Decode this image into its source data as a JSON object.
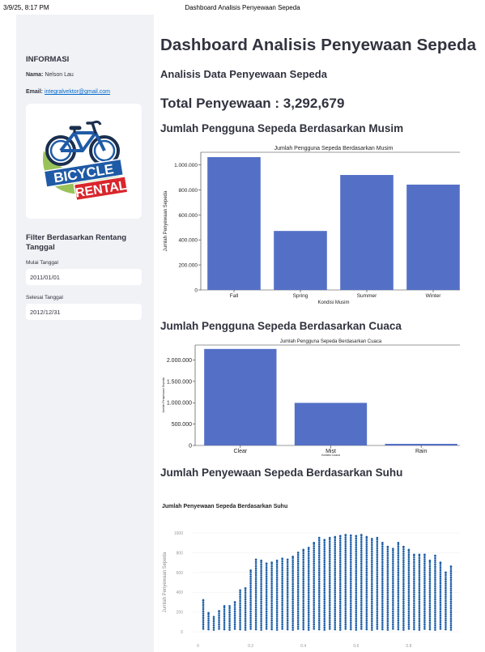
{
  "print_header": {
    "datetime": "3/9/25, 8:17 PM",
    "title": "Dashboard Analisis Penyewaan Sepeda"
  },
  "sidebar": {
    "info_title": "INFORMASI",
    "name_label": "Nama:",
    "name_value": "Nelson Lau",
    "email_label": "Email:",
    "email_value": "integralvektor@gmail.com",
    "logo": {
      "line1": "BICYCLE",
      "line2": "RENTAL",
      "colors": {
        "blue": "#1f5aa6",
        "red": "#d9262c",
        "green": "#9ac25a",
        "dark": "#1b2f4e"
      }
    },
    "filter_title": "Filter Berdasarkan Rentang Tanggal",
    "start_label": "Mulai Tanggal",
    "start_value": "2011/01/01",
    "end_label": "Selesai Tanggal",
    "end_value": "2012/12/31"
  },
  "main": {
    "title": "Dashboard Analisis Penyewaan Sepeda",
    "subtitle": "Analisis Data Penyewaan Sepeda",
    "total": "Total Penyewaan : 3,292,679",
    "section_season": "Jumlah Pengguna Sepeda Berdasarkan Musim",
    "section_weather": "Jumlah Pengguna Sepeda Berdasarkan Cuaca",
    "section_temp": "Jumlah Penyewaan Sepeda Berdasarkan Suhu"
  },
  "colors": {
    "bar": "#5470c6",
    "scatter": "#1f5fa8",
    "sidebar_bg": "#f0f2f6",
    "text": "#31333f"
  },
  "chart_data": [
    {
      "type": "bar",
      "title": "Jumlah Pengguna Sepeda Berdasarkan Musim",
      "xlabel": "Kondisi Musim",
      "ylabel": "Jumlah Penyewaan Sepeda",
      "categories": [
        "Fall",
        "Spring",
        "Summer",
        "Winter"
      ],
      "values": [
        1061129,
        471348,
        918589,
        841613
      ],
      "ylim": [
        0,
        1100000
      ],
      "yticks": [
        "0",
        "200.000",
        "400.000",
        "600.000",
        "800.000",
        "1.000.000"
      ],
      "ytick_values": [
        0,
        200000,
        400000,
        600000,
        800000,
        1000000
      ]
    },
    {
      "type": "bar",
      "title": "Jumlah Pengguna Sepeda Berdasarkan Cuaca",
      "xlabel": "Kondisi Cuaca",
      "ylabel": "Jumlah Penyewaan Sepeda",
      "categories": [
        "Clear",
        "Mist",
        "Rain"
      ],
      "values": [
        2257952,
        996858,
        37869
      ],
      "ylim": [
        0,
        2350000
      ],
      "yticks": [
        "0",
        "500.000",
        "1.000.000",
        "1.500.000",
        "2.000.000"
      ],
      "ytick_values": [
        0,
        500000,
        1000000,
        1500000,
        2000000
      ]
    },
    {
      "type": "scatter",
      "title": "Jumlah Penyewaan Sepeda Berdasarkan Suhu",
      "ylabel": "Jumlah Penyewaan Sepeda",
      "xlim": [
        -0.02,
        1.0
      ],
      "ylim": [
        0,
        1000
      ],
      "xticks": [
        "0",
        "0.2",
        "0.4",
        "0.6",
        "0.8"
      ],
      "xtick_values": [
        0,
        0.2,
        0.4,
        0.6,
        0.8
      ],
      "yticks": [
        "0",
        "200",
        "400",
        "600",
        "800",
        "1000"
      ],
      "ytick_values": [
        0,
        200,
        400,
        600,
        800,
        1000
      ],
      "columns": [
        {
          "x": 0.02,
          "max": 320
        },
        {
          "x": 0.04,
          "max": 190
        },
        {
          "x": 0.06,
          "max": 150
        },
        {
          "x": 0.08,
          "max": 210
        },
        {
          "x": 0.1,
          "max": 260
        },
        {
          "x": 0.12,
          "max": 260
        },
        {
          "x": 0.14,
          "max": 300
        },
        {
          "x": 0.16,
          "max": 420
        },
        {
          "x": 0.18,
          "max": 440
        },
        {
          "x": 0.2,
          "max": 620
        },
        {
          "x": 0.22,
          "max": 730
        },
        {
          "x": 0.24,
          "max": 720
        },
        {
          "x": 0.26,
          "max": 690
        },
        {
          "x": 0.28,
          "max": 700
        },
        {
          "x": 0.3,
          "max": 720
        },
        {
          "x": 0.32,
          "max": 740
        },
        {
          "x": 0.34,
          "max": 730
        },
        {
          "x": 0.36,
          "max": 760
        },
        {
          "x": 0.38,
          "max": 800
        },
        {
          "x": 0.4,
          "max": 830
        },
        {
          "x": 0.42,
          "max": 850
        },
        {
          "x": 0.44,
          "max": 900
        },
        {
          "x": 0.46,
          "max": 950
        },
        {
          "x": 0.48,
          "max": 930
        },
        {
          "x": 0.5,
          "max": 950
        },
        {
          "x": 0.52,
          "max": 960
        },
        {
          "x": 0.54,
          "max": 970
        },
        {
          "x": 0.56,
          "max": 980
        },
        {
          "x": 0.58,
          "max": 975
        },
        {
          "x": 0.6,
          "max": 970
        },
        {
          "x": 0.62,
          "max": 980
        },
        {
          "x": 0.64,
          "max": 960
        },
        {
          "x": 0.66,
          "max": 940
        },
        {
          "x": 0.68,
          "max": 950
        },
        {
          "x": 0.7,
          "max": 900
        },
        {
          "x": 0.72,
          "max": 860
        },
        {
          "x": 0.74,
          "max": 840
        },
        {
          "x": 0.76,
          "max": 900
        },
        {
          "x": 0.78,
          "max": 860
        },
        {
          "x": 0.8,
          "max": 830
        },
        {
          "x": 0.82,
          "max": 780
        },
        {
          "x": 0.84,
          "max": 780
        },
        {
          "x": 0.86,
          "max": 780
        },
        {
          "x": 0.88,
          "max": 720
        },
        {
          "x": 0.9,
          "max": 770
        },
        {
          "x": 0.92,
          "max": 700
        },
        {
          "x": 0.94,
          "max": 600
        },
        {
          "x": 0.96,
          "max": 660
        }
      ]
    }
  ]
}
